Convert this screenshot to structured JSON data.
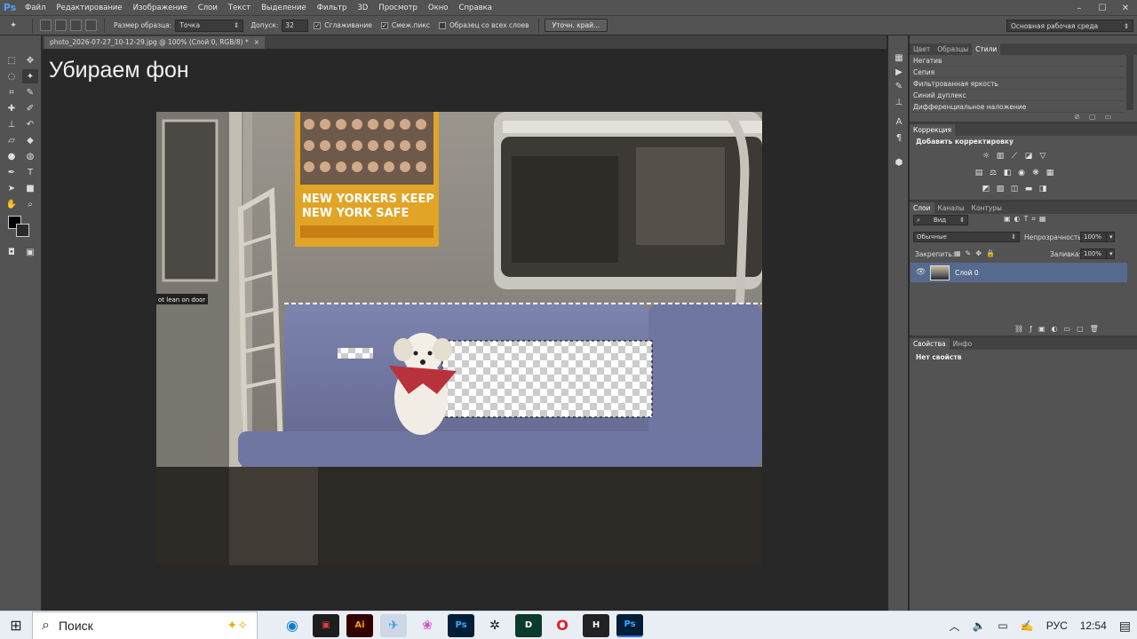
{
  "app": {
    "logo": "Ps"
  },
  "menu": [
    "Файл",
    "Редактирование",
    "Изображение",
    "Слои",
    "Текст",
    "Выделение",
    "Фильтр",
    "3D",
    "Просмотр",
    "Окно",
    "Справка"
  ],
  "window_controls": {
    "minimize": "–",
    "maximize": "☐",
    "close": "✕"
  },
  "options": {
    "sample_size_label": "Размер образца:",
    "sample_size_value": "Точка",
    "tolerance_label": "Допуск:",
    "tolerance_value": "32",
    "antialias_label": "Сглаживание",
    "contiguous_label": "Смеж.пикс",
    "all_layers_label": "Образец со всех слоев",
    "refine_edge_label": "Уточн. край...",
    "workspace": "Основная рабочая среда"
  },
  "document": {
    "tab_title": "photo_2026-07-27_10-12-29.jpg @ 100% (Слой 0, RGB/8) *",
    "tab_close": "×",
    "canvas_title": "Убираем фон"
  },
  "styles_panel": {
    "tabs": [
      "Цвет",
      "Образцы",
      "Стили"
    ],
    "active_tab": "Стили",
    "items": [
      "Негатив",
      "Сепия",
      "Фильтрованная яркость",
      "Синий дуплекс",
      "Дифференциальное наложение"
    ]
  },
  "correction_panel": {
    "tab": "Коррекция",
    "heading": "Добавить корректировку"
  },
  "layers_panel": {
    "tabs": [
      "Слои",
      "Каналы",
      "Контуры"
    ],
    "active_tab": "Слои",
    "filter": "Вид",
    "blend_mode": "Обычные",
    "opacity_label": "Непрозрачность:",
    "opacity_value": "100%",
    "lock_label": "Закрепить:",
    "fill_label": "Заливка:",
    "fill_value": "100%",
    "layer_name": "Слой 0"
  },
  "properties_panel": {
    "tabs": [
      "Свойства",
      "Инфо"
    ],
    "active_tab": "Свойства",
    "empty_text": "Нет свойств"
  },
  "taskbar": {
    "search_placeholder": "Поиск",
    "apps": [
      "Ai",
      "Ps",
      "H",
      "Ps"
    ],
    "language": "РУС",
    "time": "12:54"
  },
  "colors": {
    "accent": "#56698f",
    "panel": "#535353",
    "canvas": "#282828"
  }
}
